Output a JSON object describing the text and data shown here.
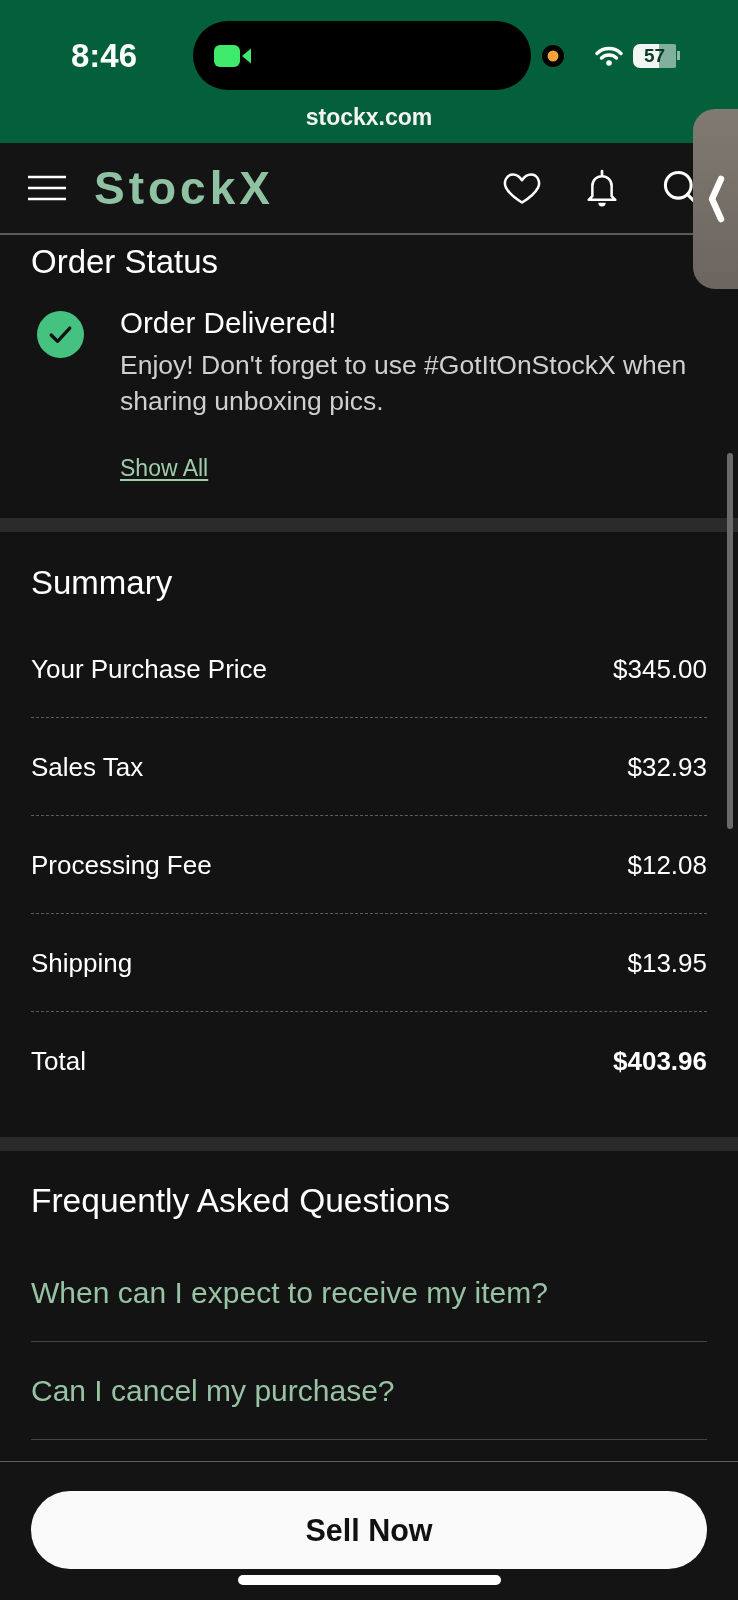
{
  "status_bar": {
    "time": "8:46",
    "battery": "57"
  },
  "browser": {
    "url": "stockx.com"
  },
  "header": {
    "logo": "StockX"
  },
  "order_status": {
    "title": "Order Status",
    "events": [
      {
        "title": "Order Delivered!",
        "description": "Enjoy! Don't forget to use #GotItOnStockX when sharing unboxing pics.",
        "done": true
      }
    ],
    "link": "Show All"
  },
  "summary": {
    "title": "Summary",
    "rows": [
      {
        "label": "Your Purchase Price",
        "value": "$345.00",
        "kind": "item"
      },
      {
        "label": "Sales Tax",
        "value": "$32.93",
        "kind": "item"
      },
      {
        "label": "Processing Fee",
        "value": "$12.08",
        "kind": "item"
      },
      {
        "label": "Shipping",
        "value": "$13.95",
        "kind": "item"
      },
      {
        "label": "Total",
        "value": "$403.96",
        "kind": "total"
      }
    ]
  },
  "faq": {
    "title": "Frequently Asked Questions",
    "questions": [
      "When can I expect to receive my item?",
      "Can I cancel my purchase?"
    ]
  },
  "footer": {
    "button": "Sell Now"
  }
}
